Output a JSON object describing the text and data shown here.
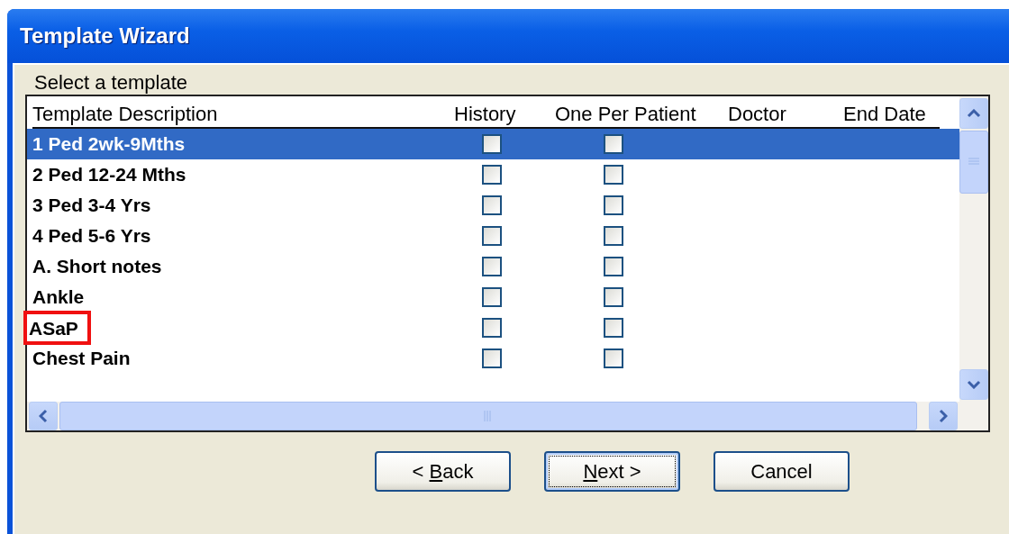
{
  "window": {
    "title": "Template Wizard"
  },
  "prompt": "Select a template",
  "table": {
    "columns": [
      "Template Description",
      "History",
      "One Per Patient",
      "Doctor",
      "End Date"
    ],
    "rows": [
      {
        "description": "1 Ped 2wk-9Mths",
        "history": false,
        "one_per_patient": false,
        "selected": true,
        "highlighted": false
      },
      {
        "description": "2 Ped 12-24 Mths",
        "history": false,
        "one_per_patient": false,
        "selected": false,
        "highlighted": false
      },
      {
        "description": "3 Ped 3-4 Yrs",
        "history": false,
        "one_per_patient": false,
        "selected": false,
        "highlighted": false
      },
      {
        "description": "4 Ped 5-6 Yrs",
        "history": false,
        "one_per_patient": false,
        "selected": false,
        "highlighted": false
      },
      {
        "description": "A. Short notes",
        "history": false,
        "one_per_patient": false,
        "selected": false,
        "highlighted": false
      },
      {
        "description": "Ankle",
        "history": false,
        "one_per_patient": false,
        "selected": false,
        "highlighted": false
      },
      {
        "description": "ASaP",
        "history": false,
        "one_per_patient": false,
        "selected": false,
        "highlighted": true
      },
      {
        "description": "Chest Pain",
        "history": false,
        "one_per_patient": false,
        "selected": false,
        "highlighted": false
      }
    ]
  },
  "buttons": [
    {
      "before": "< ",
      "access_key": "B",
      "after": "ack",
      "focused": false
    },
    {
      "access_key": "N",
      "after": "ext >",
      "focused": true
    },
    {
      "before": "Cancel",
      "focused": false
    }
  ]
}
